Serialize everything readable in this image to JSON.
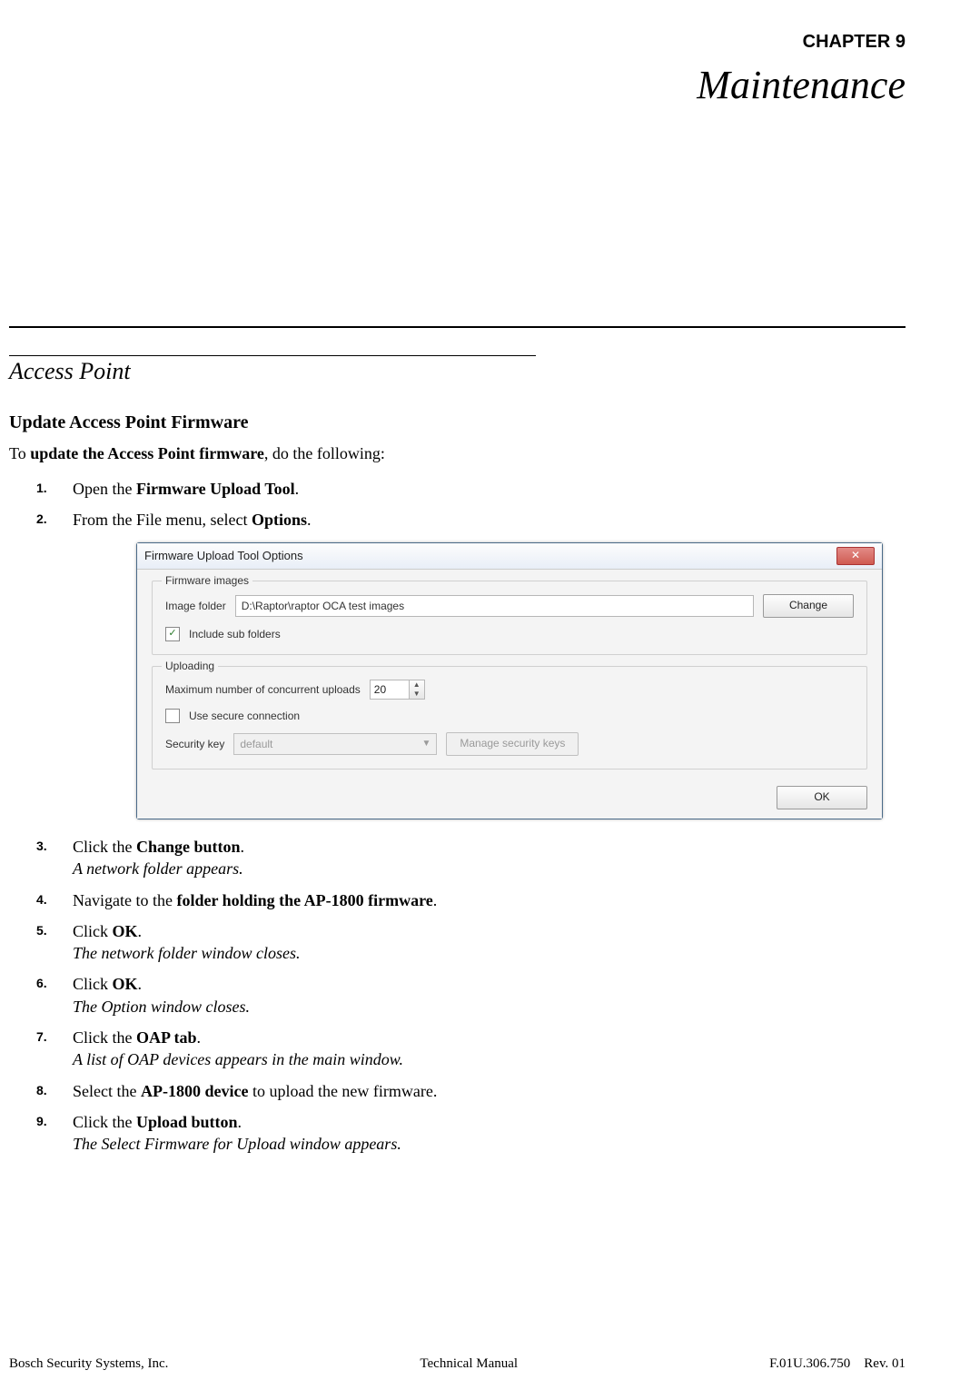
{
  "header": {
    "chapter_label": "CHAPTER 9",
    "chapter_title": "Maintenance"
  },
  "section": {
    "title": "Access Point",
    "subsection_title": "Update Access Point Firmware",
    "intro_prefix": "To ",
    "intro_bold": "update the Access Point firmware",
    "intro_suffix": ", do the following:"
  },
  "steps": {
    "s1_pre": "Open the ",
    "s1_bold": "Firmware Upload Tool",
    "s1_post": ".",
    "s2_pre": "From the File menu, select ",
    "s2_bold": "Options",
    "s2_post": ".",
    "s3_pre": "Click the ",
    "s3_bold": "Change button",
    "s3_post": ".",
    "s3_result": "A network folder appears.",
    "s4_pre": "Navigate to the ",
    "s4_bold": "folder holding the AP-1800 firmware",
    "s4_post": ".",
    "s5_pre": "Click ",
    "s5_bold": "OK",
    "s5_post": ".",
    "s5_result": "The network folder window closes.",
    "s6_pre": "Click ",
    "s6_bold": "OK",
    "s6_post": ".",
    "s6_result": "The Option window closes.",
    "s7_pre": "Click the ",
    "s7_bold": "OAP tab",
    "s7_post": ".",
    "s7_result": "A list of OAP devices appears in the main window.",
    "s8_pre": "Select the ",
    "s8_bold": "AP-1800 device",
    "s8_post": " to upload the new firmware.",
    "s9_pre": "Click the ",
    "s9_bold": "Upload button",
    "s9_post": ".",
    "s9_result": "The Select Firmware for Upload window appears."
  },
  "dialog": {
    "title": "Firmware Upload Tool Options",
    "close_glyph": "✕",
    "group_firmware": {
      "legend": "Firmware images",
      "image_folder_label": "Image folder",
      "image_folder_value": "D:\\Raptor\\raptor OCA test images",
      "change_button": "Change",
      "include_sub_label": "Include sub folders",
      "include_sub_checked_glyph": "✓"
    },
    "group_uploading": {
      "legend": "Uploading",
      "max_uploads_label": "Maximum number of concurrent uploads",
      "max_uploads_value": "20",
      "use_secure_label": "Use secure connection",
      "security_key_label": "Security key",
      "security_key_value": "default",
      "manage_keys_button": "Manage security keys"
    },
    "ok_button": "OK"
  },
  "footer": {
    "left": "Bosch Security Systems, Inc.",
    "center": "Technical Manual",
    "right_doc": "F.01U.306.750",
    "right_rev": "Rev. 01"
  }
}
